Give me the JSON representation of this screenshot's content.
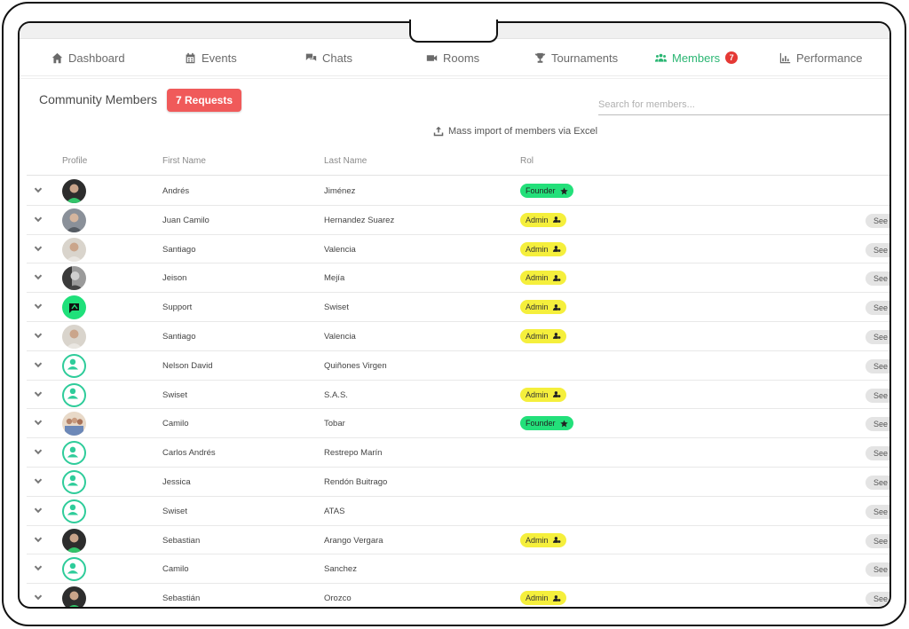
{
  "nav": {
    "items": [
      {
        "label": "Dashboard",
        "icon": "home-icon"
      },
      {
        "label": "Events",
        "icon": "calendar-icon"
      },
      {
        "label": "Chats",
        "icon": "chat-icon"
      },
      {
        "label": "Rooms",
        "icon": "video-icon"
      },
      {
        "label": "Tournaments",
        "icon": "trophy-icon"
      },
      {
        "label": "Members",
        "icon": "users-icon",
        "badge": "7",
        "active": true
      },
      {
        "label": "Performance",
        "icon": "chart-icon"
      }
    ]
  },
  "header": {
    "title": "Community Members",
    "requests_label": "7 Requests",
    "search_placeholder": "Search for members...",
    "import_label": "Mass import of members via Excel"
  },
  "table": {
    "columns": {
      "profile": "Profile",
      "first": "First Name",
      "last": "Last Name",
      "role": "Rol"
    },
    "see_label": "See J",
    "rows": [
      {
        "first": "Andrés",
        "last": "Jiménez",
        "role": "Founder",
        "avatar": "photo-dark",
        "see": false
      },
      {
        "first": "Juan Camilo",
        "last": "Hernandez Suarez",
        "role": "Admin",
        "avatar": "photo-grey",
        "see": true
      },
      {
        "first": "Santiago",
        "last": "Valencia",
        "role": "Admin",
        "avatar": "photo-light",
        "see": true
      },
      {
        "first": "Jeison",
        "last": "Mejía",
        "role": "Admin",
        "avatar": "photo-bw",
        "see": true
      },
      {
        "first": "Support",
        "last": "Swiset",
        "role": "Admin",
        "avatar": "logo-green",
        "see": true
      },
      {
        "first": "Santiago",
        "last": "Valencia",
        "role": "Admin",
        "avatar": "photo-light",
        "see": true
      },
      {
        "first": "Nelson David",
        "last": "Quiñones Virgen",
        "role": "",
        "avatar": "default",
        "see": true
      },
      {
        "first": "Swiset",
        "last": "S.A.S.",
        "role": "Admin",
        "avatar": "default",
        "see": true
      },
      {
        "first": "Camilo",
        "last": "Tobar",
        "role": "Founder",
        "avatar": "photo-group",
        "see": true
      },
      {
        "first": "Carlos Andrés",
        "last": "Restrepo Marín",
        "role": "",
        "avatar": "default",
        "see": true
      },
      {
        "first": "Jessica",
        "last": "Rendón Buitrago",
        "role": "",
        "avatar": "default",
        "see": true
      },
      {
        "first": "Swiset",
        "last": "ATAS",
        "role": "",
        "avatar": "default",
        "see": true
      },
      {
        "first": "Sebastian",
        "last": "Arango Vergara",
        "role": "Admin",
        "avatar": "photo-dark",
        "see": true
      },
      {
        "first": "Camilo",
        "last": "Sanchez",
        "role": "",
        "avatar": "default",
        "see": true
      },
      {
        "first": "Sebastián",
        "last": "Orozco",
        "role": "Admin",
        "avatar": "photo-dark",
        "see": true
      }
    ]
  },
  "colors": {
    "accent": "#2bb673",
    "requests": "#f05a5a",
    "admin": "#f5ef3c",
    "founder": "#23e07a",
    "default_avatar": "#2ecc9a"
  }
}
